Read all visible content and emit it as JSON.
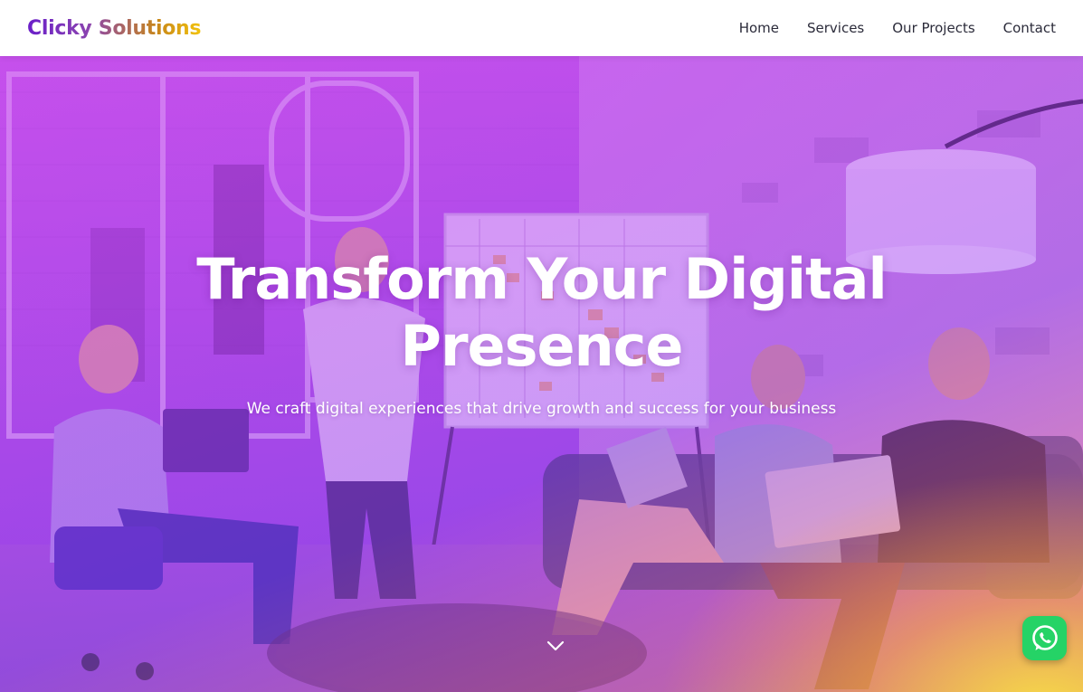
{
  "header": {
    "logo": "Clicky Solutions",
    "nav": [
      {
        "label": "Home"
      },
      {
        "label": "Services"
      },
      {
        "label": "Our Projects"
      },
      {
        "label": "Contact"
      }
    ]
  },
  "hero": {
    "title": "Transform Your Digital Presence",
    "subtitle": "We craft digital experiences that drive growth and success for your business",
    "scroll_icon": "chevron-down-icon"
  },
  "floating": {
    "whatsapp_icon": "whatsapp-icon"
  },
  "colors": {
    "logo_gradient_start": "#6a1fc9",
    "logo_gradient_end": "#f2c20b",
    "hero_overlay_purple": "#b24ee0",
    "hero_overlay_yellow": "#ffe63c",
    "whatsapp_green": "#25d366",
    "nav_text": "#2b2b3a"
  }
}
